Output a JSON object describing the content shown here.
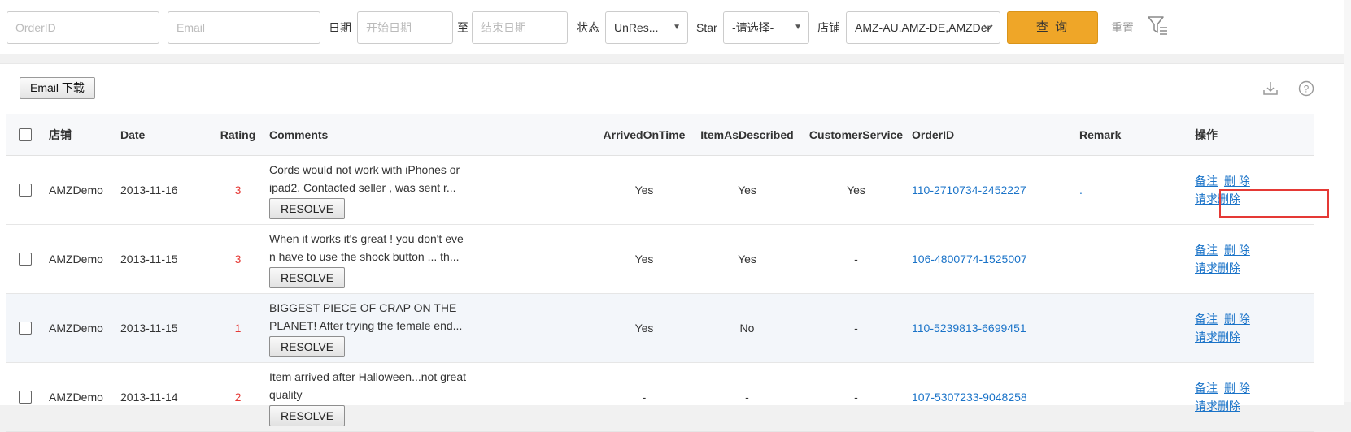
{
  "filters": {
    "order_id_placeholder": "OrderID",
    "email_placeholder": "Email",
    "date_label": "日期",
    "start_date_placeholder": "开始日期",
    "to_label": "至",
    "end_date_placeholder": "结束日期",
    "status_label": "状态",
    "status_value": "UnRes...",
    "star_label": "Star",
    "star_value": "-请选择-",
    "shop_label": "店铺",
    "shop_value": "AMZ-AU,AMZ-DE,AMZDer",
    "query_button": "查 询",
    "reset_button": "重置"
  },
  "toolbar": {
    "email_download_button": "Email 下载"
  },
  "table": {
    "headers": {
      "shop": "店铺",
      "date": "Date",
      "rating": "Rating",
      "comments": "Comments",
      "arrived_on_time": "ArrivedOnTime",
      "item_as_described": "ItemAsDescribed",
      "customer_service": "CustomerService",
      "order_id": "OrderID",
      "remark": "Remark",
      "actions": "操作"
    },
    "rows": [
      {
        "shop": "AMZDemo",
        "date": "2013-11-16",
        "rating": "3",
        "comment_line1": "Cords would not work with iPhones or",
        "comment_line2": "ipad2. Contacted seller , was sent r...",
        "resolve": "RESOLVE",
        "arrived": "Yes",
        "described": "Yes",
        "service": "Yes",
        "order_id": "110-2710734-2452227",
        "remark": ".",
        "act_note": "备注",
        "act_delete": "删 除",
        "act_request_delete": "请求删除"
      },
      {
        "shop": "AMZDemo",
        "date": "2013-11-15",
        "rating": "3",
        "comment_line1": "When it works it's great ! you don't eve",
        "comment_line2": "n have to use the shock button ... th...",
        "resolve": "RESOLVE",
        "arrived": "Yes",
        "described": "Yes",
        "service": "-",
        "order_id": "106-4800774-1525007",
        "remark": "",
        "act_note": "备注",
        "act_delete": "删 除",
        "act_request_delete": "请求删除"
      },
      {
        "shop": "AMZDemo",
        "date": "2013-11-15",
        "rating": "1",
        "comment_line1": "BIGGEST PIECE OF CRAP ON THE",
        "comment_line2": "PLANET! After trying the female end...",
        "resolve": "RESOLVE",
        "arrived": "Yes",
        "described": "No",
        "service": "-",
        "order_id": "110-5239813-6699451",
        "remark": "",
        "act_note": "备注",
        "act_delete": "删 除",
        "act_request_delete": "请求删除"
      },
      {
        "shop": "AMZDemo",
        "date": "2013-11-14",
        "rating": "2",
        "comment_line1": "Item arrived after Halloween...not great",
        "comment_line2": "quality",
        "resolve": "RESOLVE",
        "arrived": "-",
        "described": "-",
        "service": "-",
        "order_id": "107-5307233-9048258",
        "remark": "",
        "act_note": "备注",
        "act_delete": "删 除",
        "act_request_delete": "请求删除"
      }
    ]
  },
  "colors": {
    "accent_button": "#efa628",
    "link": "#1a73c8",
    "rating": "#e53935",
    "highlight_box": "#e53935"
  },
  "icons": [
    "filter-icon",
    "download-icon",
    "help-icon",
    "dropdown-caret-icon",
    "chevron-down-icon"
  ]
}
